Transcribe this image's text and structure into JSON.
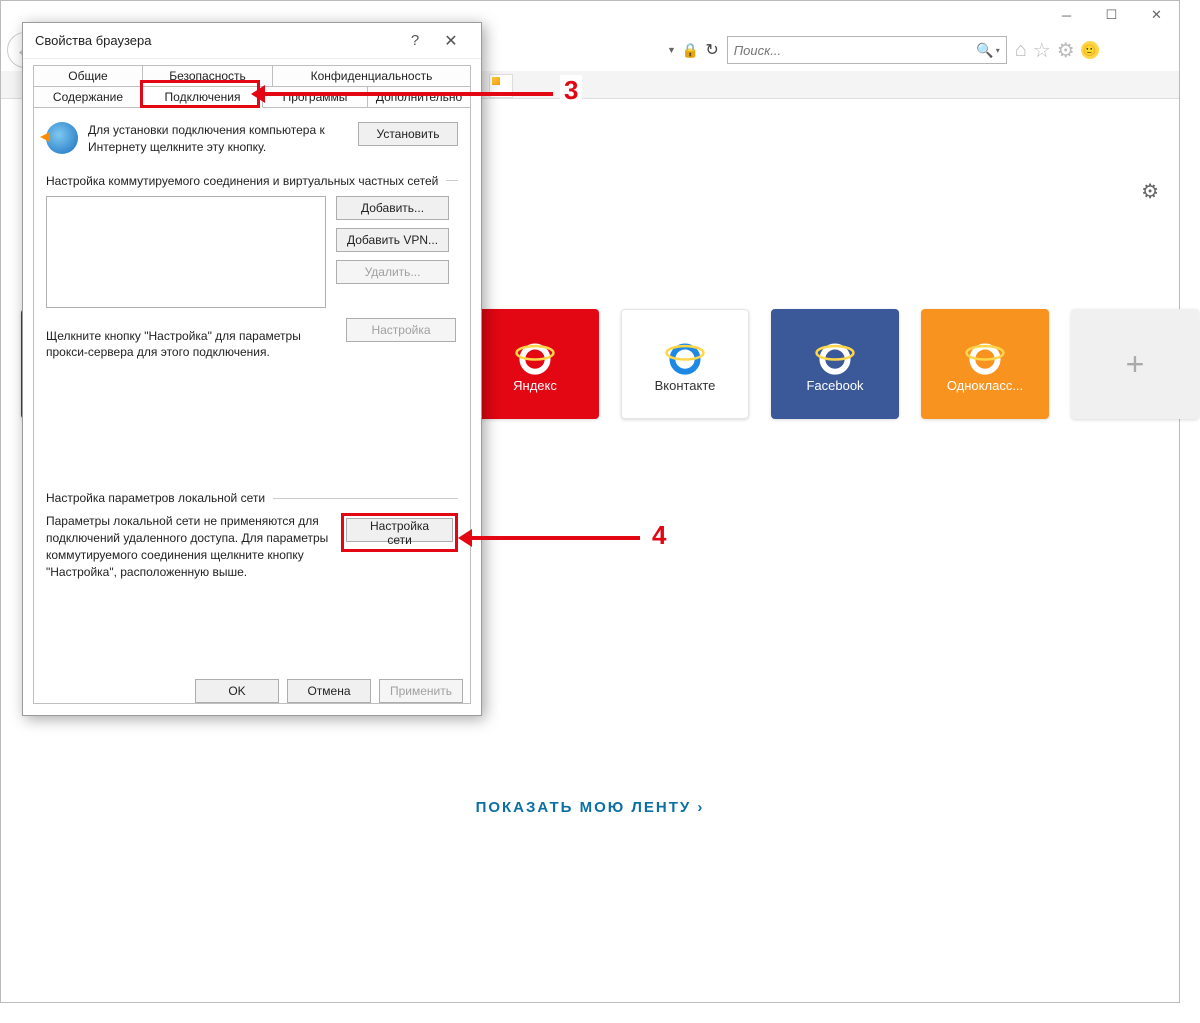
{
  "browser": {
    "search_placeholder": "Поиск...",
    "feed_link": "ПОКАЗАТЬ МОЮ ЛЕНТУ",
    "tiles": [
      {
        "label": "Яндекс",
        "bg": "#e30613",
        "fg": "#ffffff",
        "icon_color": "#ffffff"
      },
      {
        "label": "Вконтакте",
        "bg": "#ffffff",
        "fg": "#333333",
        "icon_color": "#1e88e5"
      },
      {
        "label": "Facebook",
        "bg": "#3b5998",
        "fg": "#ffffff",
        "icon_color": "#ffffff"
      },
      {
        "label": "Однокласс...",
        "bg": "#f7931e",
        "fg": "#ffffff",
        "icon_color": "#ffffff"
      }
    ]
  },
  "dialog": {
    "title": "Свойства браузера",
    "tabs_row1": [
      "Общие",
      "Безопасность",
      "Конфиденциальность"
    ],
    "tabs_row2": [
      "Содержание",
      "Подключения",
      "Программы",
      "Дополнительно"
    ],
    "setup_text": "Для установки подключения компьютера к Интернету щелкните эту кнопку.",
    "btn_install": "Установить",
    "dial_head": "Настройка коммутируемого соединения и виртуальных частных сетей",
    "btn_add": "Добавить...",
    "btn_add_vpn": "Добавить VPN...",
    "btn_remove": "Удалить...",
    "btn_settings": "Настройка",
    "proxy_hint": "Щелкните кнопку \"Настройка\" для параметры прокси-сервера для этого подключения.",
    "lan_head": "Настройка параметров локальной сети",
    "lan_text": "Параметры локальной сети не применяются для подключений удаленного доступа. Для параметры коммутируемого соединения щелкните кнопку \"Настройка\", расположенную выше.",
    "btn_lan": "Настройка сети",
    "btn_ok": "OK",
    "btn_cancel": "Отмена",
    "btn_apply": "Применить"
  },
  "annotations": {
    "step3": "3",
    "step4": "4"
  }
}
